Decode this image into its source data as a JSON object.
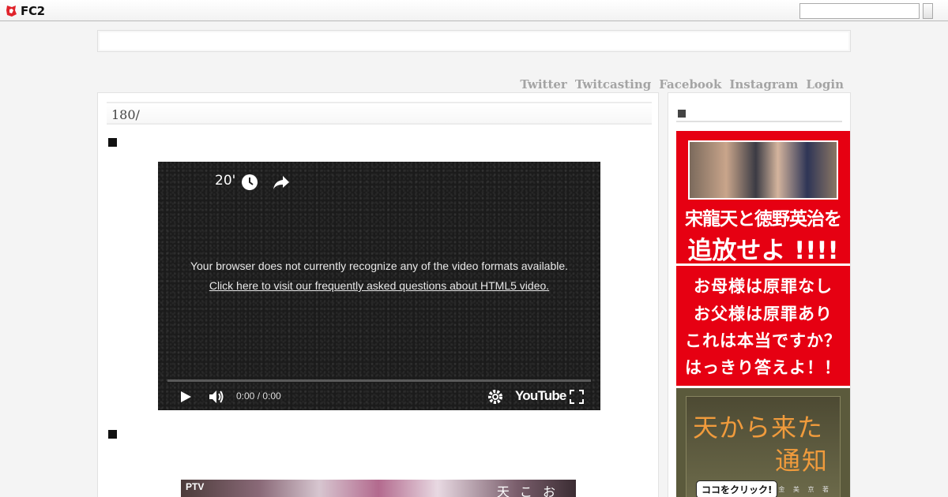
{
  "fc2bar": {
    "logo_text": "FC2",
    "search_value": "",
    "search_button_label": ""
  },
  "nav": {
    "links": [
      "Twitter",
      "Twitcasting",
      "Facebook",
      "Instagram",
      "Login"
    ]
  },
  "entry": {
    "title": "180/",
    "section_marker_1": "■",
    "section_marker_2": "■"
  },
  "video": {
    "title": "20'",
    "message_line": "Your browser does not currently recognize any of the video formats available.",
    "message_link": "Click here to visit our frequently asked questions about HTML5 video.",
    "time": "0:00 / 0:00",
    "brand": "YouTube",
    "progress": 0
  },
  "photo": {
    "logo": "PTV",
    "caption": "天 こ お"
  },
  "sidebar": {
    "header": "",
    "banner1": {
      "line1": "宋龍天と徳野英治を",
      "line2": "追放せよ !!!!"
    },
    "banner2": {
      "lines": [
        "お母様は原罪なし",
        "お父様は原罪あり",
        "これは本当ですか？",
        "はっきり答えよ！！"
      ]
    },
    "banner3": {
      "title1": "天から来た",
      "title2": "通知",
      "click": "ココをクリック!",
      "author": "金 美 京 著"
    }
  },
  "colors": {
    "banner_red": "#e60012",
    "nav_gray": "#a4a4a4",
    "video_bg": "#1b1b1b"
  },
  "icons": [
    "fc2-logo-icon",
    "clock-icon",
    "share-icon",
    "play-icon",
    "volume-icon",
    "settings-icon",
    "fullscreen-icon"
  ]
}
